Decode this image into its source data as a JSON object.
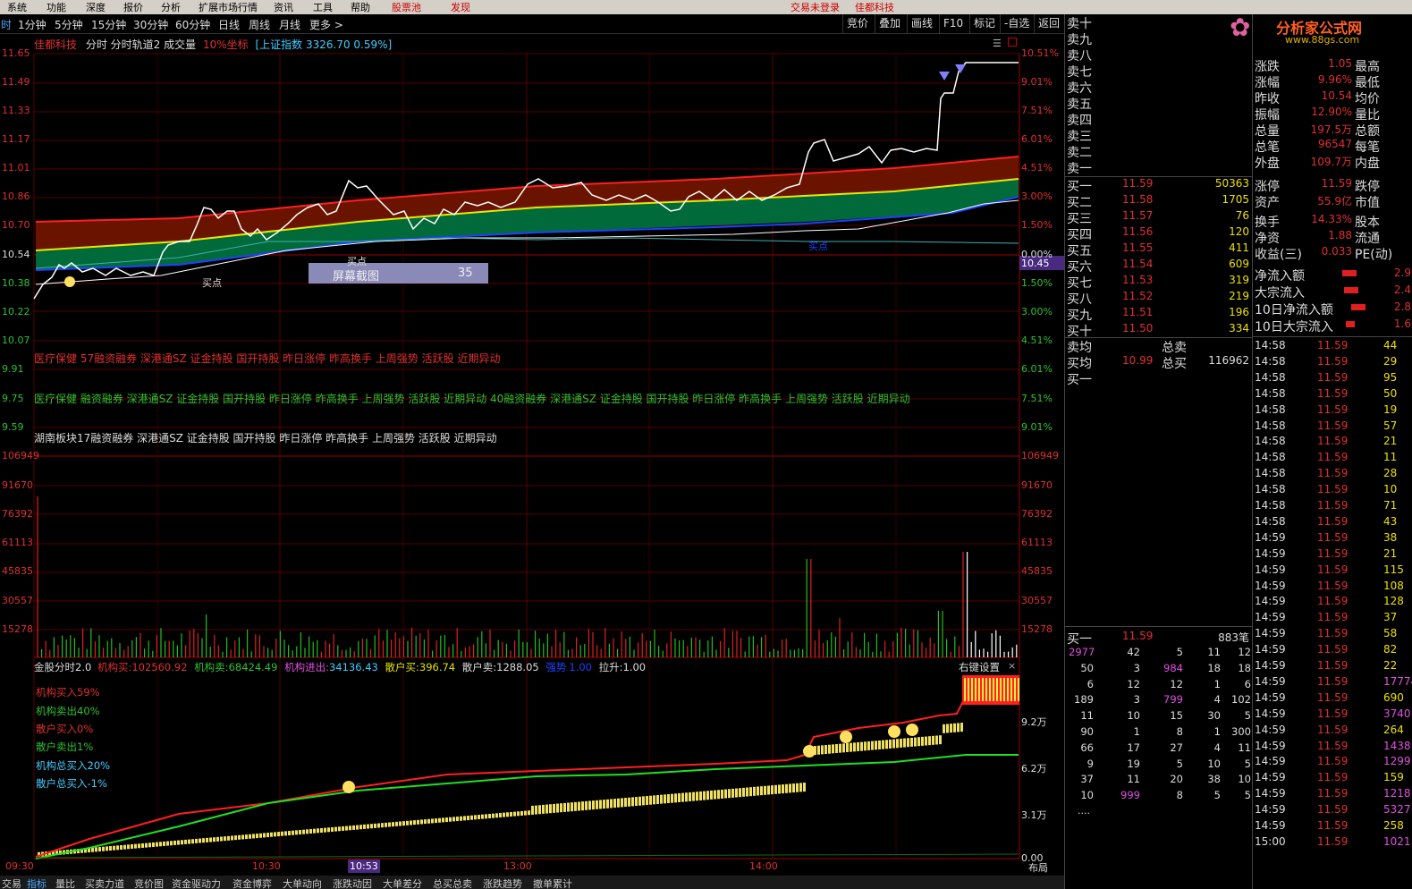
{
  "menubar": {
    "items": [
      "系统",
      "功能",
      "深度",
      "报价",
      "分析",
      "扩展市场行情",
      "资讯",
      "工具",
      "帮助",
      "股票池",
      "发现"
    ],
    "center": "交易未登录",
    "stock": "佳都科技"
  },
  "toolbar": {
    "periods": [
      "时",
      "1分钟",
      "5分钟",
      "15分钟",
      "30分钟",
      "60分钟",
      "日线",
      "周线",
      "月线",
      "更多 >"
    ],
    "buttons": [
      "竞价",
      "叠加",
      "画线",
      "F10",
      "标记",
      "-自选",
      "返回"
    ]
  },
  "chart": {
    "stock_name": "佳都科技",
    "indicators": "分时 分时轨道2 成交量",
    "pct_label": "10%坐标",
    "index_label": "[上证指数 3326.70 0.59%]",
    "left_prices": [
      "11.65",
      "11.49",
      "11.33",
      "11.17",
      "11.01",
      "10.86",
      "10.70",
      "10.54",
      "10.38",
      "10.22",
      "10.07",
      "9.91",
      "9.75",
      "9.59"
    ],
    "right_pcts": [
      "10.51%",
      "9.01%",
      "7.51%",
      "6.01%",
      "4.51%",
      "3.00%",
      "1.50%",
      "0.00%",
      "1.50%",
      "3.00%",
      "4.51%",
      "6.01%",
      "7.51%",
      "9.01%"
    ],
    "current_price": "10.45",
    "tip_box": {
      "label": "屏幕截图",
      "value": "35"
    },
    "buy_label_1": "买点",
    "buy_label_2": "买点",
    "blue_label": "买点"
  },
  "tags": {
    "line1": "医疗保健 57融资融券 深港通SZ 证金持股 国开持股 昨日涨停 昨高换手 上周强势 活跃股 近期异动",
    "line2": "医疗保健 融资融券 深港通SZ 证金持股 国开持股 昨日涨停 昨高换手 上周强势 活跃股 近期异动 40融资融券 深港通SZ 证金持股 国开持股 昨日涨停 昨高换手 上周强势 活跃股 近期异动",
    "line3": "湖南板块17融资融券 深港通SZ 证金持股 国开持股 昨日涨停 昨高换手 上周强势 活跃股 近期异动"
  },
  "volume": {
    "labels": [
      "106949",
      "91670",
      "76392",
      "61113",
      "45835",
      "30557",
      "15278"
    ]
  },
  "bottom_panel": {
    "title": "金股分时2.0",
    "items": [
      {
        "k": "机构买:",
        "v": "102560.92"
      },
      {
        "k": "机构卖:",
        "v": "68424.49"
      },
      {
        "k": "机构进出:",
        "v": "34136.43"
      },
      {
        "k": "散户买:",
        "v": "396.74"
      },
      {
        "k": "散户卖:",
        "v": "1288.05"
      }
    ],
    "flag1": "强势",
    "flag1v": "1.00",
    "flag2": "拉升:",
    "flag2v": "1.00",
    "settings": "右键设置",
    "stats": [
      "机构买入59%",
      "机构卖出40%",
      "散户买入0%",
      "散户卖出1%",
      "机构总买入20%",
      "散户总买入-1%"
    ],
    "y_labels": [
      "9.2万",
      "6.2万",
      "3.1万",
      "0.00"
    ]
  },
  "time_axis": [
    "09:30",
    "10:30",
    "10:53",
    "13:00",
    "14:00"
  ],
  "layout_btn": "布局",
  "bottom_tabs": [
    "交易",
    "指标",
    "量比",
    "买卖力道",
    "竞价图",
    "资金驱动力",
    "资金博弈",
    "大单动向",
    "涨跌动因",
    "大单差分",
    "总买总卖",
    "涨跌趋势",
    "撤单累计"
  ],
  "orderbook": {
    "sell": [
      "卖十",
      "卖九",
      "卖八",
      "卖七",
      "卖六",
      "卖五",
      "卖四",
      "卖三",
      "卖二",
      "卖一"
    ],
    "buy": [
      {
        "l": "买一",
        "p": "11.59",
        "v": "50363"
      },
      {
        "l": "买二",
        "p": "11.58",
        "v": "1705"
      },
      {
        "l": "买三",
        "p": "11.57",
        "v": "76"
      },
      {
        "l": "买四",
        "p": "11.56",
        "v": "120"
      },
      {
        "l": "买五",
        "p": "11.55",
        "v": "411"
      },
      {
        "l": "买六",
        "p": "11.54",
        "v": "609"
      },
      {
        "l": "买七",
        "p": "11.53",
        "v": "319"
      },
      {
        "l": "买八",
        "p": "11.52",
        "v": "219"
      },
      {
        "l": "买九",
        "p": "11.51",
        "v": "196"
      },
      {
        "l": "买十",
        "p": "11.50",
        "v": "334"
      }
    ],
    "avg_sell": "卖均",
    "total_sell": "总卖",
    "avg_buy": "买均",
    "avg_buy_v": "10.99",
    "total_buy": "总买",
    "total_buy_v": "116962",
    "buy1": "买一",
    "queue_label": "买一",
    "queue_price": "11.59",
    "queue_count": "883笔",
    "queue": [
      [
        "2977",
        "42",
        "5",
        "11",
        "12"
      ],
      [
        "50",
        "3",
        "984",
        "18",
        "18"
      ],
      [
        "6",
        "12",
        "12",
        "1",
        "6"
      ],
      [
        "189",
        "3",
        "799",
        "4",
        "102"
      ],
      [
        "11",
        "10",
        "15",
        "30",
        "5"
      ],
      [
        "90",
        "1",
        "8",
        "1",
        "300"
      ],
      [
        "66",
        "17",
        "27",
        "4",
        "11"
      ],
      [
        "9",
        "19",
        "5",
        "10",
        "5"
      ],
      [
        "37",
        "11",
        "20",
        "38",
        "10"
      ],
      [
        "10",
        "999",
        "8",
        "5",
        "5"
      ]
    ],
    "more": "...."
  },
  "stats": {
    "brand": "分析家公式网",
    "url": "www.88gs.com",
    "rows": [
      {
        "k1": "涨跌",
        "v1": "1.05",
        "k2": "最高"
      },
      {
        "k1": "涨幅",
        "v1": "9.96%",
        "k2": "最低"
      },
      {
        "k1": "昨收",
        "v1": "10.54",
        "k2": "均价"
      },
      {
        "k1": "振幅",
        "v1": "12.90%",
        "k2": "量比"
      },
      {
        "k1": "总量",
        "v1": "197.5万",
        "k2": "总额"
      },
      {
        "k1": "总笔",
        "v1": "96547",
        "k2": "每笔"
      },
      {
        "k1": "外盘",
        "v1": "109.7万",
        "k2": "内盘"
      },
      {
        "k1": "涨停",
        "v1": "11.59",
        "k2": "跌停"
      },
      {
        "k1": "资产",
        "v1": "55.9亿",
        "k2": "市值"
      },
      {
        "k1": "换手",
        "v1": "14.33%",
        "k2": "股本"
      },
      {
        "k1": "净资",
        "v1": "1.88",
        "k2": "流通"
      },
      {
        "k1": "收益(三)",
        "v1": "0.033",
        "k2": "PE(动)"
      }
    ],
    "flows": [
      {
        "k": "净流入额",
        "v": "2.9"
      },
      {
        "k": "大宗流入",
        "v": "2.4"
      },
      {
        "k": "10日净流入额",
        "v": "2.8"
      },
      {
        "k": "10日大宗流入",
        "v": "1.6"
      }
    ],
    "ticks": [
      [
        "14:58",
        "11.59",
        "44"
      ],
      [
        "14:58",
        "11.59",
        "29"
      ],
      [
        "14:58",
        "11.59",
        "95"
      ],
      [
        "14:58",
        "11.59",
        "50"
      ],
      [
        "14:58",
        "11.59",
        "19"
      ],
      [
        "14:58",
        "11.59",
        "57"
      ],
      [
        "14:58",
        "11.59",
        "21"
      ],
      [
        "14:58",
        "11.59",
        "11"
      ],
      [
        "14:58",
        "11.59",
        "28"
      ],
      [
        "14:58",
        "11.59",
        "10"
      ],
      [
        "14:58",
        "11.59",
        "71"
      ],
      [
        "14:58",
        "11.59",
        "43"
      ],
      [
        "14:59",
        "11.59",
        "38"
      ],
      [
        "14:59",
        "11.59",
        "21"
      ],
      [
        "14:59",
        "11.59",
        "115"
      ],
      [
        "14:59",
        "11.59",
        "108"
      ],
      [
        "14:59",
        "11.59",
        "128"
      ],
      [
        "14:59",
        "11.59",
        "37"
      ],
      [
        "14:59",
        "11.59",
        "58"
      ],
      [
        "14:59",
        "11.59",
        "82"
      ],
      [
        "14:59",
        "11.59",
        "22"
      ],
      [
        "14:59",
        "11.59",
        "17774"
      ],
      [
        "14:59",
        "11.59",
        "690"
      ],
      [
        "14:59",
        "11.59",
        "3740"
      ],
      [
        "14:59",
        "11.59",
        "264"
      ],
      [
        "14:59",
        "11.59",
        "1438"
      ],
      [
        "14:59",
        "11.59",
        "1299"
      ],
      [
        "14:59",
        "11.59",
        "159"
      ],
      [
        "14:59",
        "11.59",
        "1218"
      ],
      [
        "14:59",
        "11.59",
        "5327"
      ],
      [
        "14:59",
        "11.59",
        "258"
      ],
      [
        "15:00",
        "11.59",
        "1021"
      ]
    ]
  }
}
